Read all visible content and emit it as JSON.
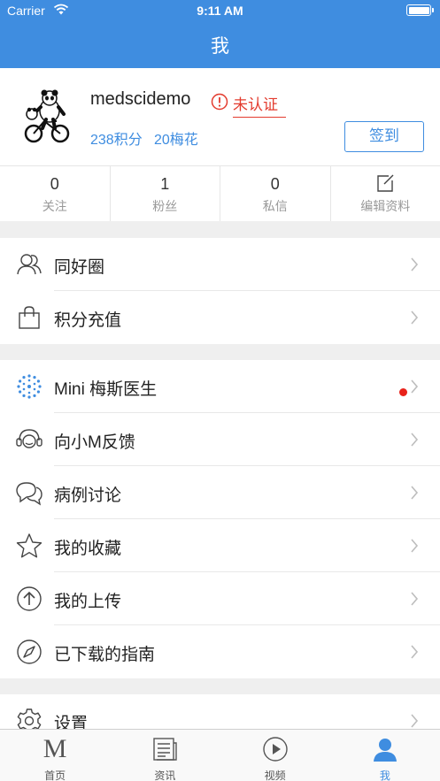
{
  "status_bar": {
    "carrier": "Carrier",
    "time": "9:11 AM"
  },
  "header": {
    "title": "我"
  },
  "profile": {
    "username": "medscidemo",
    "verify_status": "未认证",
    "points": "238积分",
    "blossoms": "20梅花",
    "checkin_label": "签到"
  },
  "stats": [
    {
      "count": "0",
      "label": "关注"
    },
    {
      "count": "1",
      "label": "粉丝"
    },
    {
      "count": "0",
      "label": "私信"
    },
    {
      "label": "编辑资料",
      "icon": "edit-icon"
    }
  ],
  "menu_groups": [
    [
      {
        "label": "同好圈",
        "icon": "friends-icon"
      },
      {
        "label": "积分充值",
        "icon": "shopping-bag-icon"
      }
    ],
    [
      {
        "label": "Mini 梅斯医生",
        "icon": "mini-doctor-icon",
        "has_badge": true
      },
      {
        "label": "向小M反馈",
        "icon": "headset-icon"
      },
      {
        "label": "病例讨论",
        "icon": "chat-bubbles-icon"
      },
      {
        "label": "我的收藏",
        "icon": "star-icon"
      },
      {
        "label": "我的上传",
        "icon": "upload-icon"
      },
      {
        "label": "已下载的指南",
        "icon": "compass-icon"
      }
    ],
    [
      {
        "label": "设置",
        "icon": "gear-icon"
      }
    ]
  ],
  "tabbar": [
    {
      "label": "首页",
      "icon": "home-m-icon",
      "glyph": "M"
    },
    {
      "label": "资讯",
      "icon": "news-icon"
    },
    {
      "label": "视频",
      "icon": "video-play-icon"
    },
    {
      "label": "我",
      "icon": "person-icon",
      "active": true
    }
  ],
  "colors": {
    "primary": "#3f8de0",
    "alert": "#e33b2e",
    "badge": "#e8221a"
  }
}
